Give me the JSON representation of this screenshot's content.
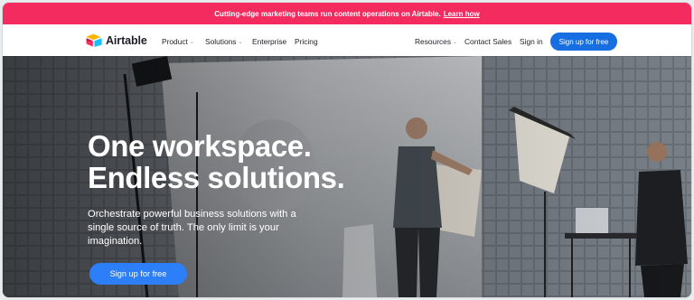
{
  "announcement": {
    "text": "Cutting-edge marketing teams run content operations on Airtable.",
    "link": "Learn how"
  },
  "nav": {
    "brand": "Airtable",
    "product": "Product",
    "solutions": "Solutions",
    "enterprise": "Enterprise",
    "pricing": "Pricing",
    "resources": "Resources",
    "contact_sales": "Contact Sales",
    "sign_in": "Sign in",
    "sign_up": "Sign up for free"
  },
  "hero": {
    "title_line1": "One workspace.",
    "title_line2": "Endless solutions.",
    "subtitle": "Orchestrate powerful business solutions with a single source of truth. The only limit is your imagination.",
    "cta": "Sign up for free"
  },
  "colors": {
    "announcement_bg": "#f32b5f",
    "nav_cta": "#166ee1",
    "hero_cta": "#2d7ff9"
  }
}
